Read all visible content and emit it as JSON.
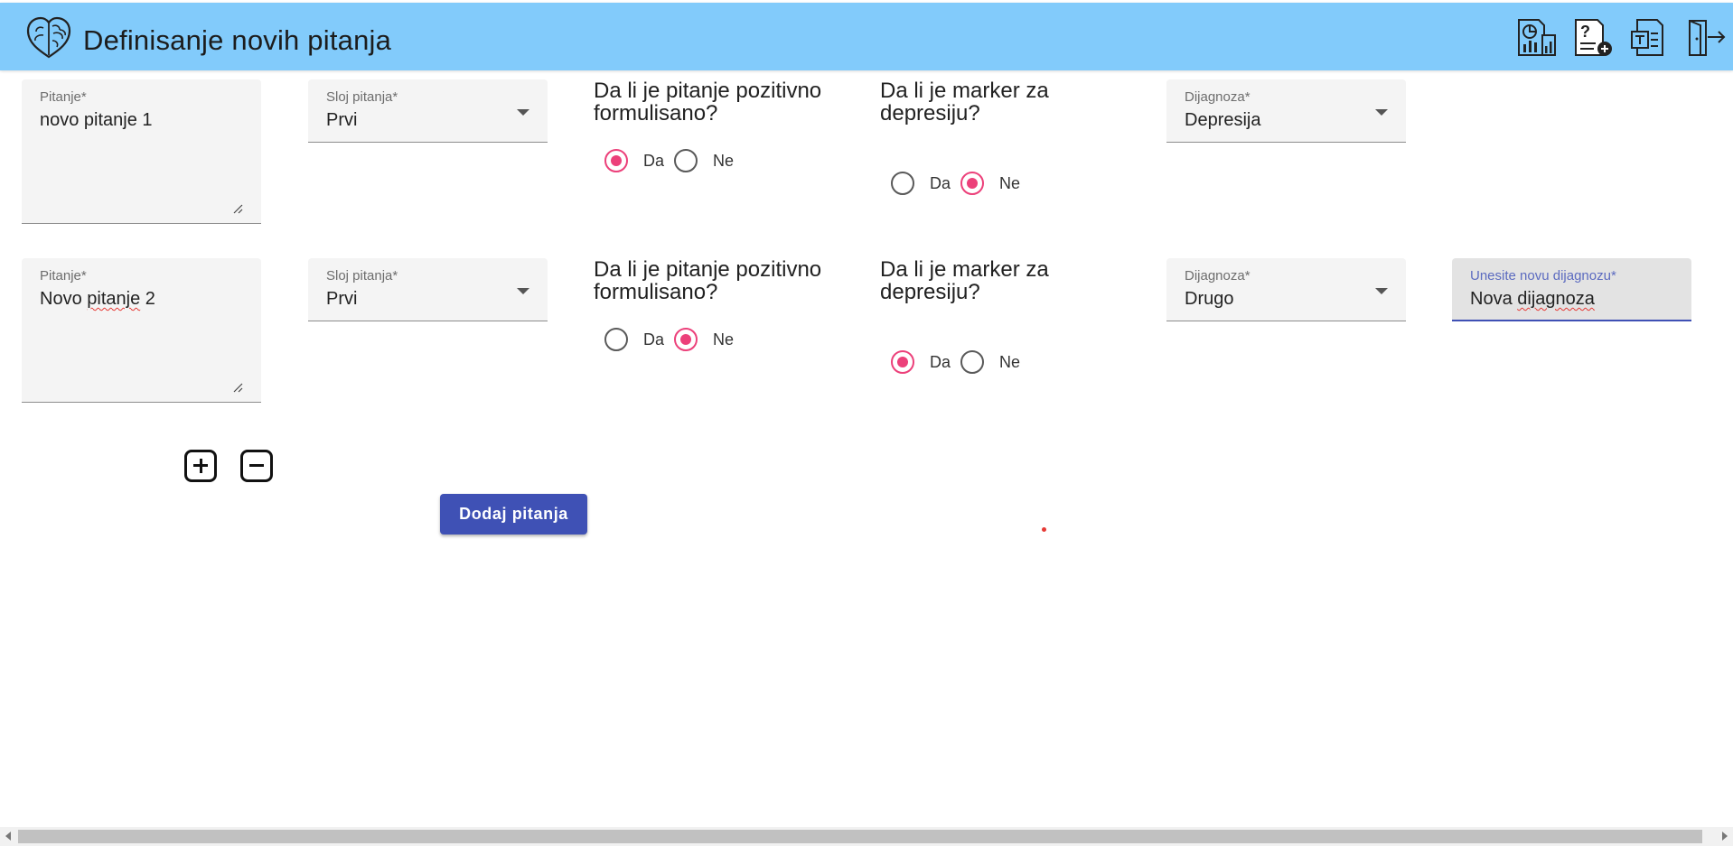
{
  "app": {
    "title": "Definisanje novih pitanja",
    "logo_icon": "brain-heart-icon"
  },
  "toolbar": {
    "icons": [
      "report-chart-icon",
      "add-question-icon",
      "document-icon",
      "logout-icon"
    ]
  },
  "labels": {
    "question_field": "Pitanje*",
    "layer_field": "Sloj pitanja*",
    "diagnosis_field": "Dijagnoza*",
    "new_diagnosis_field": "Unesite novu dijagnozu*",
    "positive_question": "Da li je pitanje pozitivno formulisano?",
    "depression_marker": "Da li je marker za depresiju?",
    "yes": "Da",
    "no": "Ne"
  },
  "rows": [
    {
      "question": "novo pitanje 1",
      "layer": "Prvi",
      "positive": "Da",
      "marker": "Ne",
      "diagnosis": "Depresija"
    },
    {
      "question_prefix": "Novo ",
      "question_misspelled": "pitanje",
      "question_suffix": " 2",
      "layer": "Prvi",
      "positive": "Ne",
      "marker": "Da",
      "diagnosis": "Drugo",
      "new_diagnosis_prefix": "Nova ",
      "new_diagnosis_misspelled": "dijagnoza"
    }
  ],
  "actions": {
    "add_row_icon": "plus-square-icon",
    "remove_row_icon": "minus-square-icon",
    "submit_label": "Dodaj pitanja"
  },
  "colors": {
    "header": "#82cbfb",
    "radio_accent": "#ec407a",
    "primary": "#3f51b5"
  }
}
